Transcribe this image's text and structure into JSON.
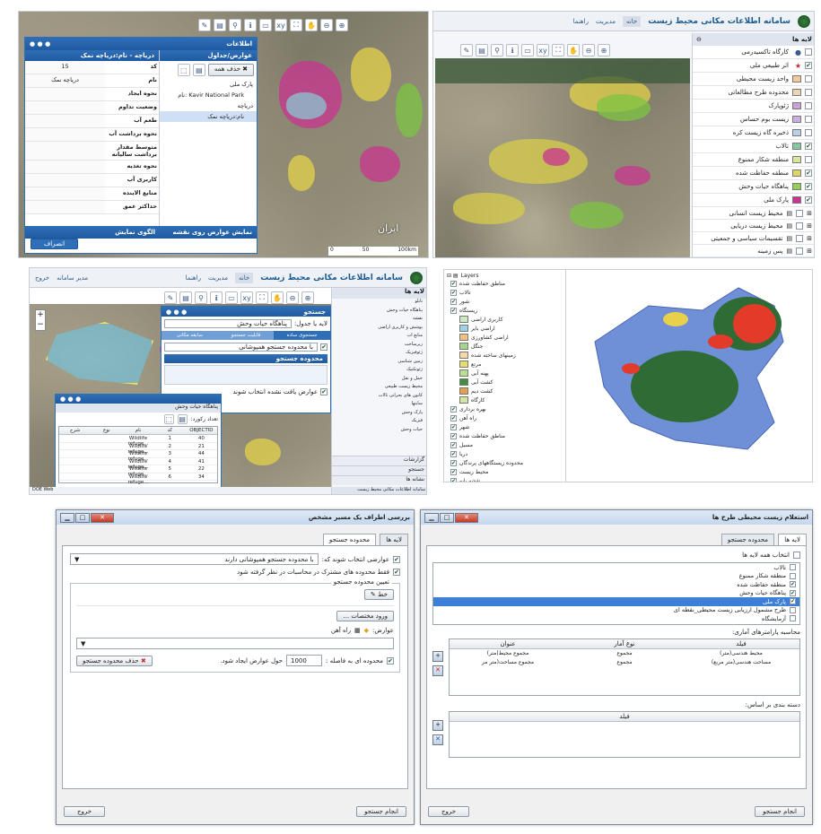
{
  "app_title": "سامانه اطلاعات مکانی محیط زیست",
  "nav": {
    "home": "خانه",
    "manage": "مدیریت",
    "help": "راهنما",
    "manager": "مدیر سامانه",
    "logout": "خروج"
  },
  "layers_panel": {
    "title": "لایه ها",
    "items": [
      {
        "label": "کارگاه تاکسیدرمی",
        "checked": false,
        "color": ""
      },
      {
        "label": "اثر طبیعی ملی",
        "checked": true,
        "color": ""
      },
      {
        "label": "واحد زیست محیطی",
        "checked": false,
        "color": "#f3c9a0"
      },
      {
        "label": "محدوده طرح مطالعاتی",
        "checked": false,
        "color": "#ead6b4"
      },
      {
        "label": "ژئوپارک",
        "checked": false,
        "color": "#c7a3d8"
      },
      {
        "label": "زیست بوم حساس",
        "checked": false,
        "color": "#c8b0e0"
      },
      {
        "label": "ذخیره گاه زیست کره",
        "checked": false,
        "color": "#b9cfe8"
      },
      {
        "label": "تالاب",
        "checked": true,
        "color": "#86c6a6"
      },
      {
        "label": "منطقه شکار ممنوع",
        "checked": false,
        "color": "#d9e6a0"
      },
      {
        "label": "منطقه حفاظت شده",
        "checked": true,
        "color": "#e0d56a"
      },
      {
        "label": "پناهگاه حیات وحش",
        "checked": true,
        "color": "#92d05a"
      },
      {
        "label": "پارک ملی",
        "checked": true,
        "color": "#c8348f"
      }
    ],
    "groups": [
      "محیط زیست انسانی",
      "محیط زیست دریایی",
      "تقسیمات سیاسی و جمعیتی",
      "پس زمینه"
    ]
  },
  "info_window": {
    "title": "اطلاعات",
    "left_title": "دریاچه - نام:دریاچه نمک",
    "right_title": "عوارض/جداول",
    "delete_label": "حذف همه",
    "tree": [
      "پارک ملی",
      "Kavir National Park :نام",
      "دریاچه",
      "نام:دریاچه نمک"
    ],
    "attributes": [
      {
        "key": "کد",
        "value": "15"
      },
      {
        "key": "نام",
        "value": "دریاچه نمک"
      },
      {
        "key": "نحوه ایجاد",
        "value": ""
      },
      {
        "key": "وضعیت تداوم",
        "value": ""
      },
      {
        "key": "طعم آب",
        "value": ""
      },
      {
        "key": "نحوه برداشت آب",
        "value": ""
      },
      {
        "key": "متوسط مقدار برداشت سالیانه",
        "value": ""
      },
      {
        "key": "نحوه تغذیه",
        "value": ""
      },
      {
        "key": "کاربری آب",
        "value": ""
      },
      {
        "key": "منابع الاینده",
        "value": ""
      },
      {
        "key": "حداکثر عمق",
        "value": ""
      }
    ],
    "footer_left": "الگوی نمایش",
    "footer_right": "نمایش عوارض روی نقشه",
    "cancel": "انصراف",
    "map_label": "ایران",
    "scale": [
      "0",
      "50",
      "100km"
    ]
  },
  "search_panel": {
    "title": "جستجو",
    "layer_label": "لایه یا جدول:",
    "layer_value": "پناهگاه حیات وحش",
    "tabs": [
      "جستجوی ساده",
      "قابلیت جستجو",
      "سابقه مکانی"
    ],
    "option": "با محدوده جستجو همپوشانی",
    "section": "محدوده جستجو",
    "note": "عوارض یافت نشده انتخاب شوند",
    "side_items": [
      "تابلو",
      "پناهگاه حیات وحش",
      "نقشه",
      "پوشش و کاربری اراضی",
      "منابع آب",
      "زیرساخت",
      "ژئوفیزیک",
      "زمین شناسی",
      "ژئوتکنیک",
      "حمل و نقل",
      "محیط زیست طبیعی",
      "کانون های بحرانی تالاب",
      "سایتها",
      "پارک وحش",
      "فیزیک",
      "حیات وحش"
    ],
    "side_footers": [
      "گزارشات",
      "جستجو",
      "نشانه ها"
    ],
    "result_window": {
      "title": "پناهگاه حیات وحش",
      "count": "تعداد رکورد:",
      "cols": [
        "OBJECTID",
        "کد",
        "نام",
        "نوع",
        "شرح"
      ],
      "rows": [
        [
          "40",
          "1",
          "Wildlife refuge..."
        ],
        [
          "21",
          "2",
          "Wildlife refuge..."
        ],
        [
          "44",
          "3",
          "Wildlife refuge..."
        ],
        [
          "41",
          "4",
          "Wildlife refuge..."
        ],
        [
          "22",
          "5",
          "Wildlife refuge..."
        ],
        [
          "34",
          "6",
          "Wildlife refuge..."
        ]
      ]
    },
    "status": "DOE Web"
  },
  "layers_tree_panel": {
    "title": "Layers",
    "items": [
      "مناطق حفاظت شده",
      "تالاب",
      "شور",
      "زیستگاه",
      "کاربری اراضی",
      "اراضی بایر",
      "اراضی کشاورزی",
      "جنگل",
      "زمینهای ساخته شده",
      "مرتع",
      "پهنه آبی",
      "کشت آبی",
      "کشت دیم",
      "کارگاه",
      "بهره برداری",
      "راه آهن",
      "شهر",
      "مناطق حفاظت شده",
      "مسیل",
      "دریا",
      "محدوده زیستگاههای پرندگان",
      "محیط زیست",
      "نقشه پایه"
    ]
  },
  "dialog_left": {
    "title": "بررسی اطراف یک مسیر مشخص",
    "tabs": [
      "محدوده جستجو",
      "لایه ها"
    ],
    "condition_label": "عوارضی انتخاب شوند که:",
    "condition_value": "با محدوده جستجو همپوشانی دارند",
    "consider_common": "فقط محدوده های مشترک در محاسبات در نظر گرفته شود",
    "define_area": "تعیین محدوده جستجو",
    "line_btn": "خط",
    "enter_coords": "ورود مختصات ...",
    "features_label": "عوارض:",
    "features_value": "راه آهن",
    "distance_label": "محدوده ای به فاصله :",
    "distance_value": "1000",
    "distance_suffix": "حول عوارض ایجاد شود.",
    "delete_area": "حذف محدوده جستجو",
    "run": "انجام جستجو",
    "exit": "خروج"
  },
  "dialog_right": {
    "title": "استعلام زیست محیطی طرح ها",
    "tabs": [
      "لایه ها",
      "محدوده جستجو"
    ],
    "select_all": "انتخاب همه لایه ها",
    "layers": [
      {
        "label": "تالاب",
        "checked": false
      },
      {
        "label": "منطقه شکار ممنوع",
        "checked": false
      },
      {
        "label": "منطقه حفاظت شده",
        "checked": true
      },
      {
        "label": "پناهگاه حیات وحش",
        "checked": true
      },
      {
        "label": "پارک ملی",
        "checked": true
      },
      {
        "label": "طرح مشمول ارزیابی زیست محیطی_نقطه ای",
        "checked": false
      },
      {
        "label": "آزمایشگاه",
        "checked": false
      }
    ],
    "stats_label": "محاسبه پارامترهای آماری:",
    "stats_cols": [
      "فیلد",
      "نوع آمار",
      "عنوان"
    ],
    "stats_rows": [
      [
        "محیط هندسی(متر)",
        "مجموع",
        "مجموع محیط(متر)"
      ],
      [
        "مساحت هندسی(متر مربع)",
        "مجموع",
        "مجموع مساحت(متر مر"
      ]
    ],
    "group_label": "دسته بندی بر اساس:",
    "group_col": "فیلد",
    "run": "انجام جستجو",
    "exit": "خروج"
  }
}
